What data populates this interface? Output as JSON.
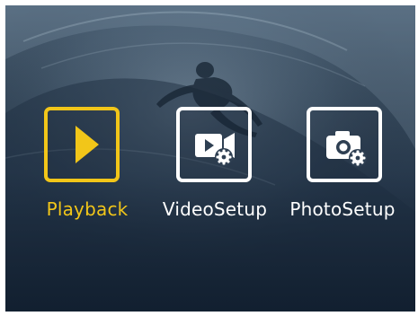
{
  "menu": {
    "selected": "playback",
    "accent_color": "#f2c619",
    "items": [
      {
        "label": "Playback",
        "icon": "play-icon",
        "selected": true
      },
      {
        "label": "VideoSetup",
        "icon": "video-settings-icon",
        "selected": false
      },
      {
        "label": "PhotoSetup",
        "icon": "camera-settings-icon",
        "selected": false
      }
    ]
  }
}
